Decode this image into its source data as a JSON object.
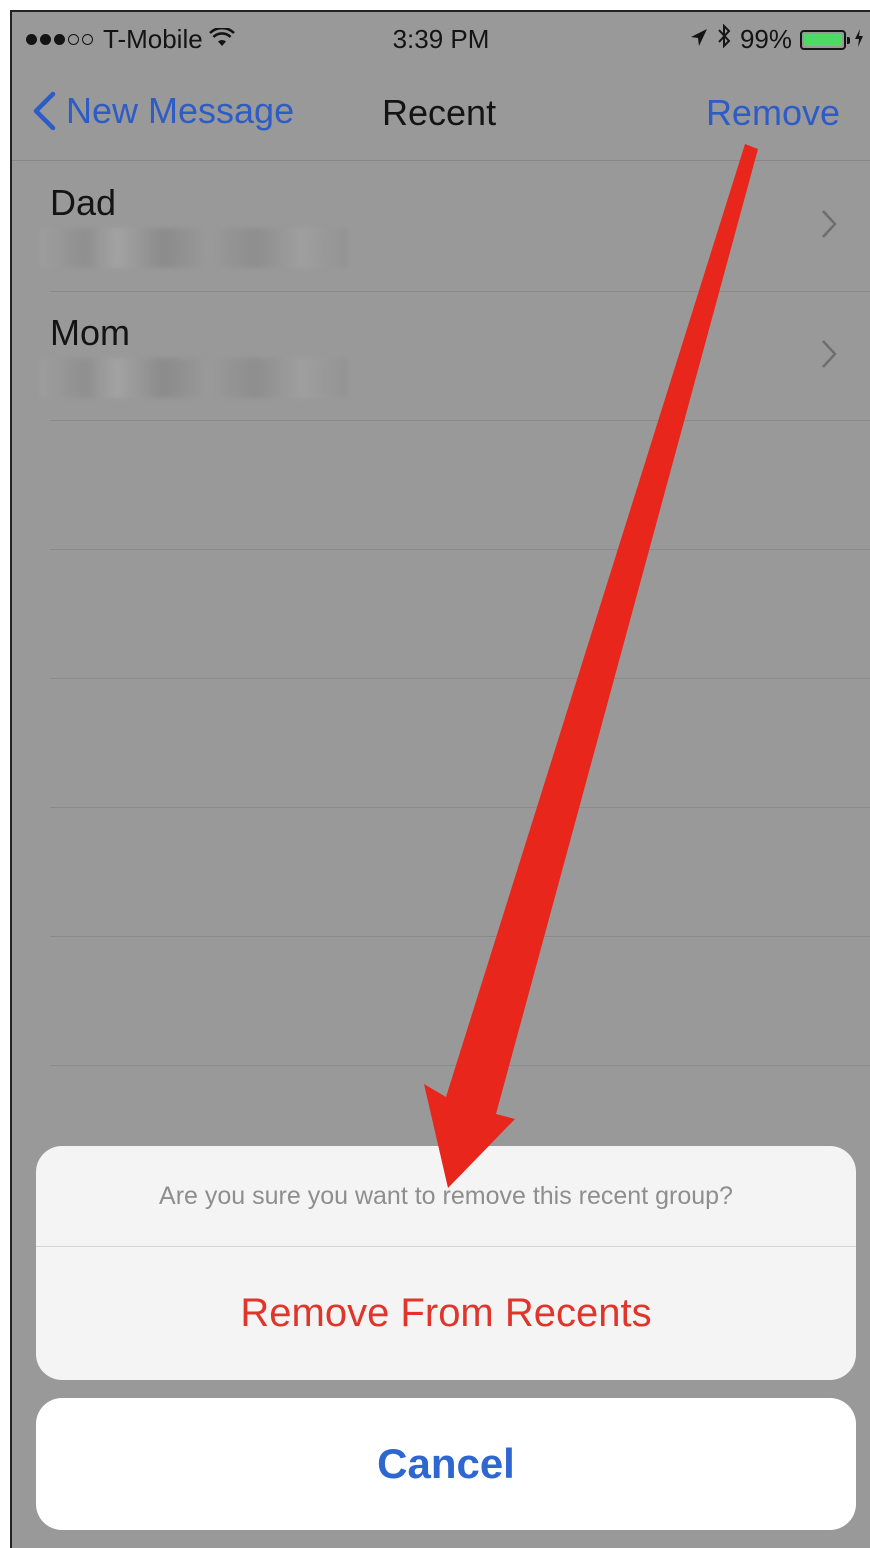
{
  "status_bar": {
    "carrier": "T-Mobile",
    "time": "3:39 PM",
    "battery": "99%",
    "battery_level": 0.99,
    "signal_dots_filled": 3,
    "signal_dots_total": 5,
    "icons": [
      "wifi-icon",
      "location-icon",
      "bluetooth-icon",
      "battery-icon",
      "charging-icon"
    ]
  },
  "navbar": {
    "back_label": "New Message",
    "title": "Recent",
    "action_label": "Remove"
  },
  "recents": [
    {
      "name": "Dad"
    },
    {
      "name": "Mom"
    }
  ],
  "action_sheet": {
    "message": "Are you sure you want to remove this recent group?",
    "destructive_label": "Remove From Recents",
    "cancel_label": "Cancel"
  },
  "colors": {
    "link_blue": "#2e5cc7",
    "destructive_red": "#e0352b",
    "annotation_arrow": "#e8261c",
    "battery_green": "#4cd964"
  }
}
